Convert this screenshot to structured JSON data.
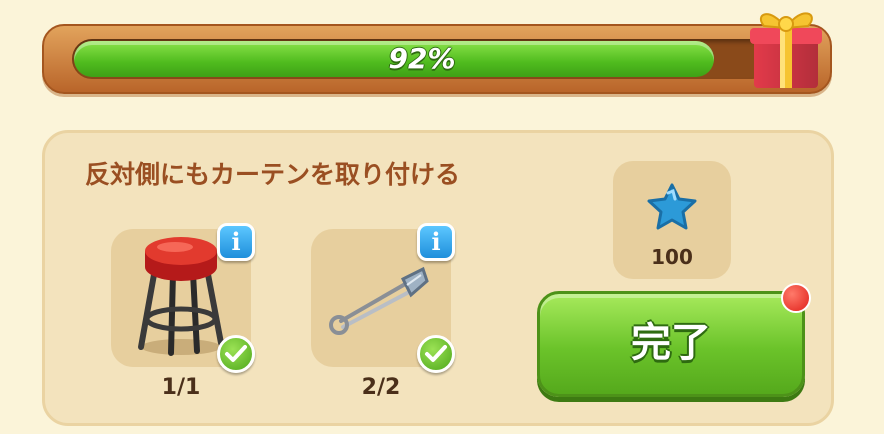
{
  "progress": {
    "percent_label": "92%",
    "fraction": 0.92
  },
  "task": {
    "title": "反対側にもカーテンを取り付ける",
    "items": [
      {
        "name": "stool",
        "count": "1/1",
        "completed": true
      },
      {
        "name": "safety-pin",
        "count": "2/2",
        "completed": true
      }
    ]
  },
  "reward": {
    "icon": "blue-star-icon",
    "amount": "100"
  },
  "buttons": {
    "complete_label": "完了"
  },
  "colors": {
    "progress_green": "#4fbb1e",
    "frame_brown": "#b9652a",
    "title_brown": "#9a4f22",
    "star_blue": "#2c9ad8",
    "notify_red": "#e0201a"
  }
}
